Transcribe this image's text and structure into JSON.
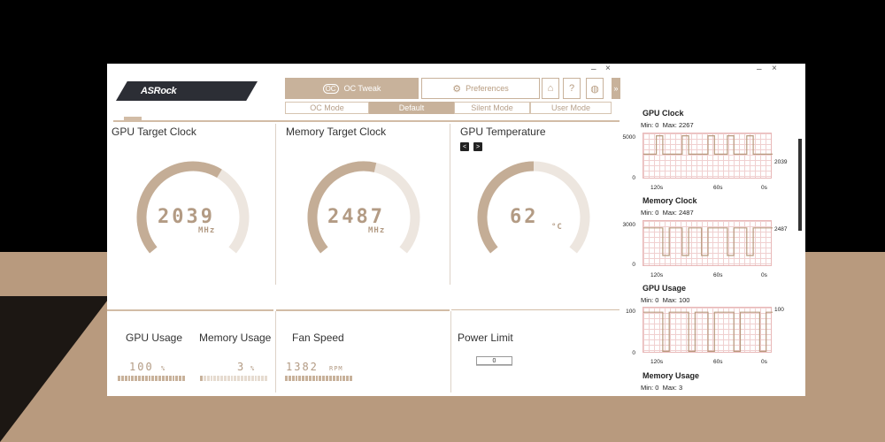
{
  "app": {
    "logo": "ASRock"
  },
  "window_controls": {
    "minimize": "–",
    "close": "×"
  },
  "tabs": {
    "oc_tweak_icon": "OC",
    "oc_tweak": "OC Tweak",
    "preferences_icon": "⚙",
    "preferences": "Preferences"
  },
  "icon_buttons": [
    "home-icon",
    "help-icon",
    "globe-icon",
    "expand-arrow-icon"
  ],
  "icon_glyphs": {
    "home": "⌂",
    "help": "?",
    "globe": "◍",
    "expand": "»"
  },
  "modes": [
    {
      "label": "OC Mode",
      "active": false
    },
    {
      "label": "Default",
      "active": true
    },
    {
      "label": "Silent Mode",
      "active": false
    },
    {
      "label": "User Mode",
      "active": false
    }
  ],
  "panels": {
    "gpu_clock": {
      "title": "GPU Target Clock",
      "value": "2039",
      "unit": "MHz",
      "fill": 0.62
    },
    "mem_clock": {
      "title": "Memory Target Clock",
      "value": "2487",
      "unit": "MHz",
      "fill": 0.55
    },
    "gpu_temp": {
      "title": "GPU Temperature",
      "value": "62",
      "unit": "°C",
      "fill": 0.5,
      "nav_prev": "<",
      "nav_next": ">"
    }
  },
  "stats": {
    "gpu_usage": {
      "label": "GPU Usage",
      "value": "100",
      "unit": "%",
      "level": 1.0
    },
    "mem_usage": {
      "label": "Memory Usage",
      "value": "3",
      "unit": "%",
      "level": 0.03
    },
    "fan_speed": {
      "label": "Fan Speed",
      "value": "1382",
      "unit": "RPM",
      "level": 1.0
    },
    "power_limit": {
      "label": "Power Limit",
      "value": "0"
    }
  },
  "monitors": [
    {
      "title": "GPU Clock",
      "min_label": "Min: 0",
      "max_label": "Max: 2267",
      "ymax": "5000",
      "ymin": "0",
      "current": "2039",
      "x_labels": [
        "120s",
        "60s",
        "0s"
      ]
    },
    {
      "title": "Memory Clock",
      "min_label": "Min: 0",
      "max_label": "Max: 2487",
      "ymax": "3000",
      "ymin": "0",
      "current": "2487",
      "x_labels": [
        "120s",
        "60s",
        "0s"
      ]
    },
    {
      "title": "GPU Usage",
      "min_label": "Min: 0",
      "max_label": "Max: 100",
      "ymax": "100",
      "ymin": "0",
      "current": "100",
      "x_labels": [
        "120s",
        "60s",
        "0s"
      ]
    },
    {
      "title": "Memory Usage",
      "min_label": "Min: 0",
      "max_label": "Max: 3"
    }
  ],
  "colors": {
    "accent": "#c8b29b",
    "gauge_track": "#ede6df",
    "gauge_fill": "#c4ad96"
  }
}
